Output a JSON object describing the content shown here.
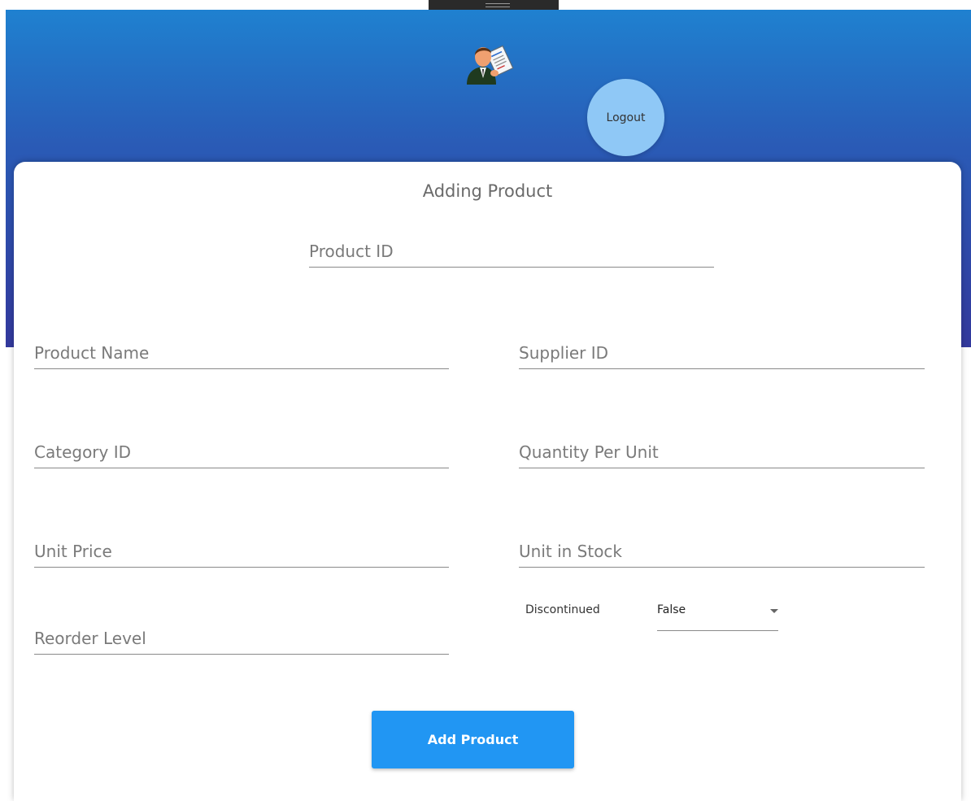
{
  "header": {
    "logout_label": "Logout",
    "gradient_top": "#1f81d0",
    "gradient_bottom": "#33399d"
  },
  "card": {
    "title": "Adding Product"
  },
  "form": {
    "product_id_placeholder": "Product ID",
    "product_name_placeholder": "Product Name",
    "supplier_id_placeholder": "Supplier ID",
    "category_id_placeholder": "Category ID",
    "quantity_per_unit_placeholder": "Quantity Per Unit",
    "unit_price_placeholder": "Unit Price",
    "unit_in_stock_placeholder": "Unit in Stock",
    "reorder_level_placeholder": "Reorder Level",
    "discontinued_label": "Discontinued",
    "discontinued_value": "False",
    "submit_label": "Add Product",
    "submit_color": "#2196f3"
  },
  "icons": {
    "avatar": "businessman-with-document-icon",
    "select_caret": "caret-down-icon"
  }
}
